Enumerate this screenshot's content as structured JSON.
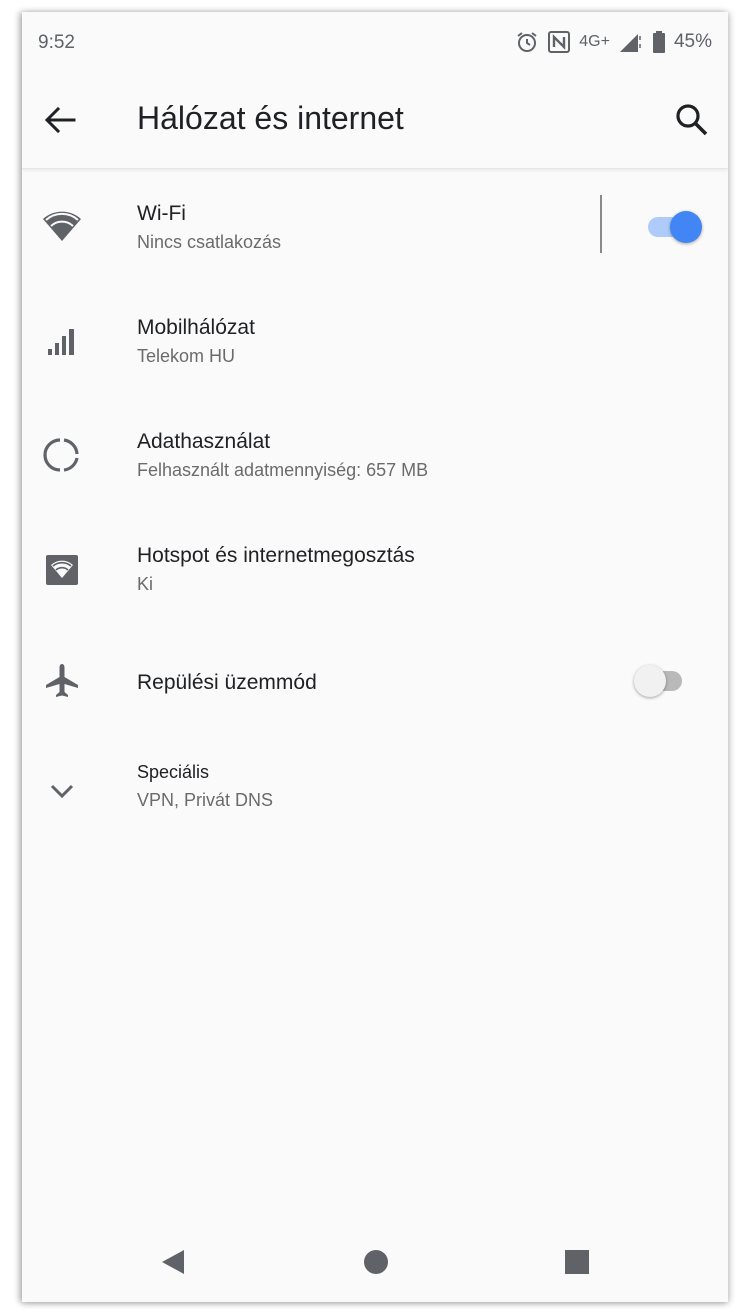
{
  "status_bar": {
    "time": "9:52",
    "network_type": "4G+",
    "battery_percent": "45%",
    "icons": [
      "alarm-icon",
      "nfc-icon",
      "signal-icon",
      "battery-icon"
    ]
  },
  "app_bar": {
    "title": "Hálózat és internet",
    "back_icon": "arrow-back-icon",
    "search_icon": "search-icon"
  },
  "items": [
    {
      "title": "Wi-Fi",
      "subtitle": "Nincs csatlakozás",
      "icon": "wifi-icon",
      "toggle_on": true
    },
    {
      "title": "Mobilhálózat",
      "subtitle": "Telekom HU",
      "icon": "cellular-signal-icon"
    },
    {
      "title": "Adathasználat",
      "subtitle": "Felhasznált adatmennyiség: 657 MB",
      "icon": "data-usage-icon"
    },
    {
      "title": "Hotspot és internetmegosztás",
      "subtitle": "Ki",
      "icon": "hotspot-icon"
    },
    {
      "title": "Repülési üzemmód",
      "icon": "airplane-icon",
      "toggle_on": false
    },
    {
      "title": "Speciális",
      "subtitle": "VPN, Privát DNS",
      "icon": "chevron-down-icon"
    }
  ],
  "colors": {
    "accent": "#4285f4",
    "accent_track": "#aecbfa",
    "icon_gray": "#5f6368",
    "background": "#fafafa"
  },
  "nav_bar": {
    "buttons": [
      "back-triangle-icon",
      "home-circle-icon",
      "recents-square-icon"
    ]
  }
}
